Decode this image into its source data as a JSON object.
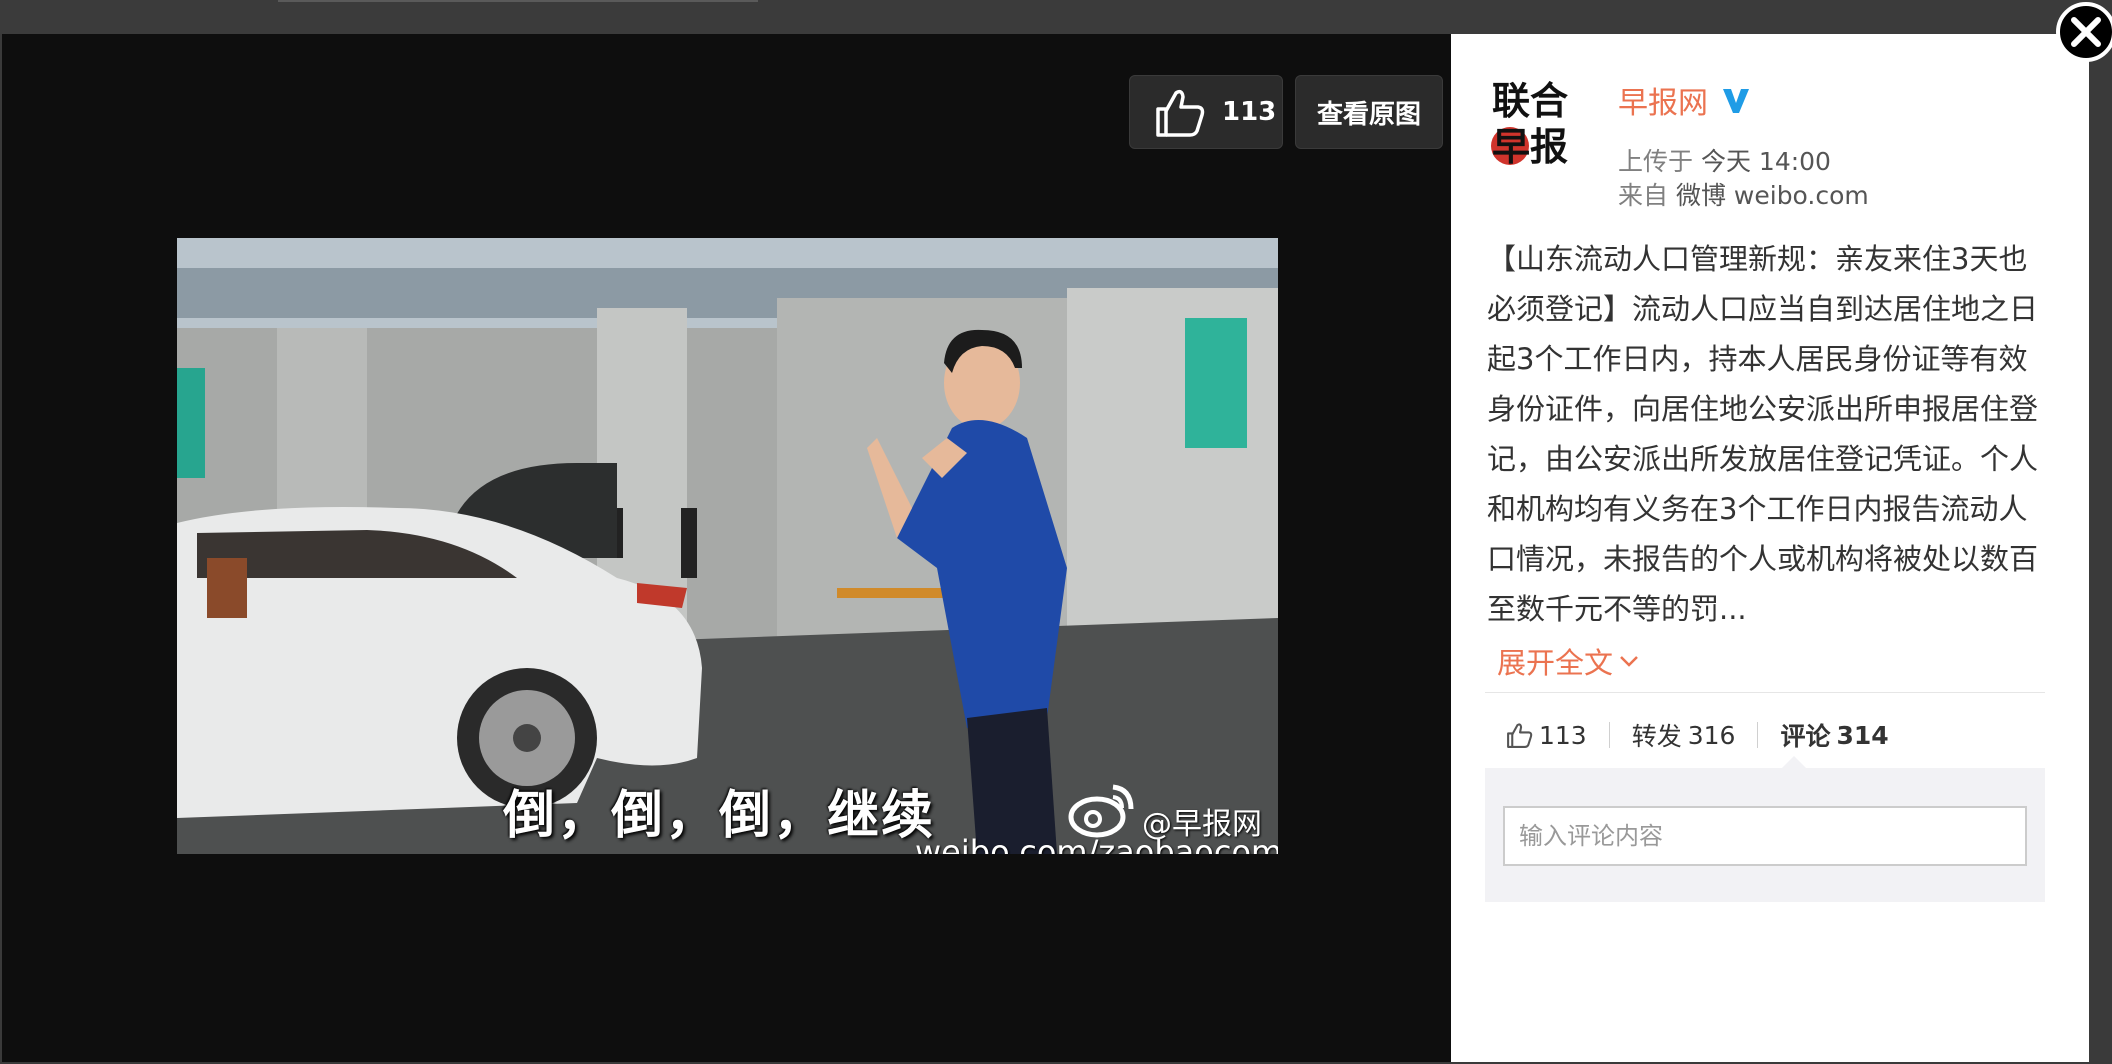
{
  "viewer": {
    "like_count": "113",
    "view_original_label": "查看原图",
    "image": {
      "caption_overlay": "倒，倒，倒，继续",
      "watermark_handle": "@早报网",
      "watermark_url": "weibo.com/zaobaocom"
    }
  },
  "post": {
    "avatar_text_top": "联合",
    "avatar_text_bottom": "早报",
    "username": "早报网",
    "uploaded_label": "上传于",
    "uploaded_time": "今天 14:00",
    "from_label": "来自",
    "from_source": "微博 weibo.com",
    "body": "【山东流动人口管理新规：亲友来住3天也必须登记】流动人口应当自到达居住地之日起3个工作日内，持本人居民身份证等有效身份证件，向居住地公安派出所申报居住登记，由公安派出所发放居住登记凭证。个人和机构均有义务在3个工作日内报告流动人口情况，未报告的个人或机构将被处以数百至数千元不等的罚...",
    "expand_label": "展开全文",
    "actions": {
      "like_count": "113",
      "repost_label": "转发",
      "repost_count": "316",
      "comment_label": "评论",
      "comment_count": "314"
    },
    "comment_placeholder": "输入评论内容"
  },
  "colors": {
    "accent": "#eb7350",
    "verified": "#1f9ce6",
    "viewer_bg": "#0e0e0e"
  },
  "icons": [
    "thumbs-up-icon",
    "verified-badge-icon",
    "chevron-down-icon",
    "close-icon",
    "weibo-logo-icon"
  ]
}
